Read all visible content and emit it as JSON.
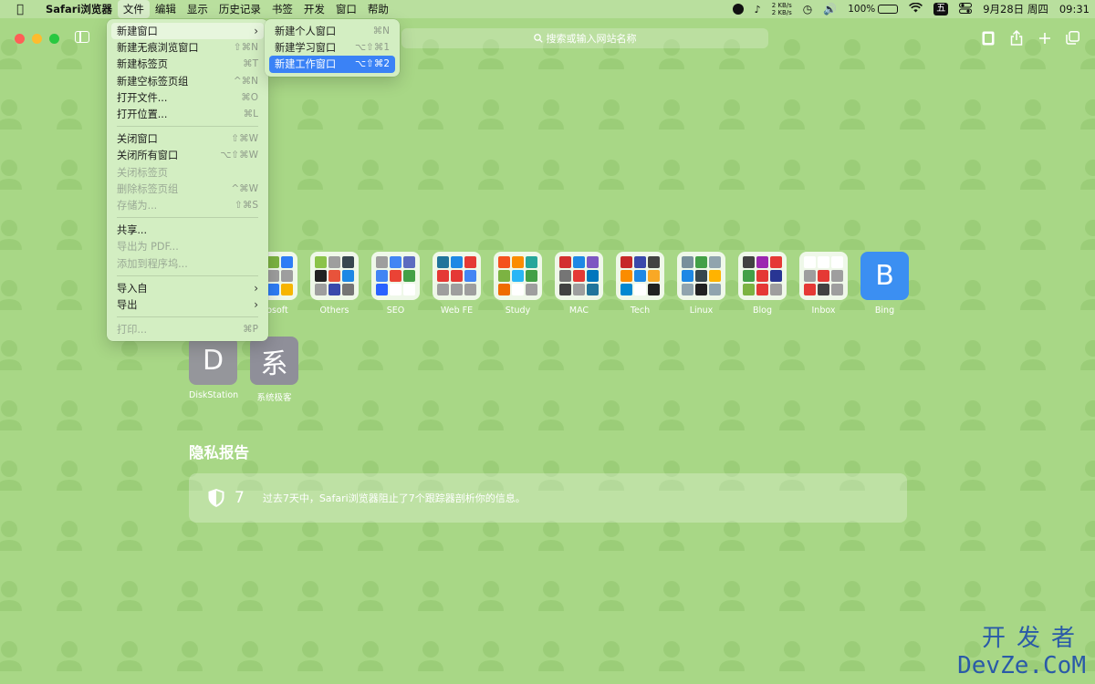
{
  "menubar": {
    "app_name": "Safari浏览器",
    "items": [
      "文件",
      "编辑",
      "显示",
      "历史记录",
      "书签",
      "开发",
      "窗口",
      "帮助"
    ],
    "active_index": 0,
    "status": {
      "net_up": "2 KB/s",
      "net_down": "2 KB/s",
      "battery": "100%",
      "battery_level": 1.0,
      "input_method": "五",
      "date": "9月28日 周四",
      "time": "09:31"
    }
  },
  "toolbar": {
    "address_placeholder": "搜索或输入网站名称"
  },
  "file_menu": [
    {
      "label": "新建窗口",
      "shortcut": "",
      "submenu": true,
      "state": "hover"
    },
    {
      "label": "新建无痕浏览窗口",
      "shortcut": "⇧⌘N"
    },
    {
      "label": "新建标签页",
      "shortcut": "⌘T"
    },
    {
      "label": "新建空标签页组",
      "shortcut": "^⌘N"
    },
    {
      "label": "打开文件...",
      "shortcut": "⌘O"
    },
    {
      "label": "打开位置...",
      "shortcut": "⌘L"
    },
    {
      "sep": true
    },
    {
      "label": "关闭窗口",
      "shortcut": "⇧⌘W"
    },
    {
      "label": "关闭所有窗口",
      "shortcut": "⌥⇧⌘W"
    },
    {
      "label": "关闭标签页",
      "shortcut": "",
      "state": "disabled"
    },
    {
      "label": "删除标签页组",
      "shortcut": "^⌘W",
      "state": "disabled"
    },
    {
      "label": "存储为...",
      "shortcut": "⇧⌘S",
      "state": "disabled"
    },
    {
      "sep": true
    },
    {
      "label": "共享...",
      "shortcut": ""
    },
    {
      "label": "导出为 PDF...",
      "shortcut": "",
      "state": "disabled"
    },
    {
      "label": "添加到程序坞...",
      "shortcut": "",
      "state": "disabled"
    },
    {
      "sep": true
    },
    {
      "label": "导入自",
      "shortcut": "",
      "submenu": true
    },
    {
      "label": "导出",
      "shortcut": "",
      "submenu": true
    },
    {
      "sep": true
    },
    {
      "label": "打印...",
      "shortcut": "⌘P",
      "state": "disabled"
    }
  ],
  "new_window_submenu": [
    {
      "label": "新建个人窗口",
      "shortcut": "⌘N"
    },
    {
      "label": "新建学习窗口",
      "shortcut": "⌥⇧⌘1"
    },
    {
      "label": "新建工作窗口",
      "shortcut": "⌥⇧⌘2",
      "state": "selected"
    }
  ],
  "favorites": [
    {
      "label": "crosoft",
      "icon": "folder",
      "tiles": [
        "#e8533b",
        "#7cb342",
        "#2e7df6",
        "#f7b500",
        "#9e9e9e",
        "#9e9e9e",
        "#e8533b",
        "#2e7df6",
        "#f7b500"
      ]
    },
    {
      "label": "Others",
      "icon": "folder",
      "tiles": [
        "#8bc34a",
        "#9e9e9e",
        "#37474f",
        "#222222",
        "#e8533b",
        "#1e88e5",
        "#9e9e9e",
        "#3949ab",
        "#757575"
      ]
    },
    {
      "label": "SEO",
      "icon": "folder",
      "tiles": [
        "#9e9e9e",
        "#4285f4",
        "#5c6bc0",
        "#4285f4",
        "#ea4335",
        "#43a047",
        "#2962ff",
        "#ffffff",
        "#ffffff"
      ]
    },
    {
      "label": "Web FE",
      "icon": "folder",
      "tiles": [
        "#21759b",
        "#1e88e5",
        "#e53935",
        "#e53935",
        "#e53935",
        "#4285f4",
        "#9e9e9e",
        "#9e9e9e",
        "#9e9e9e"
      ]
    },
    {
      "label": "Study",
      "icon": "folder",
      "tiles": [
        "#f4511e",
        "#fb8c00",
        "#26a69a",
        "#7cb342",
        "#29b6f6",
        "#43a047",
        "#ef6c00",
        "#ffffff",
        "#9e9e9e"
      ]
    },
    {
      "label": "MAC",
      "icon": "folder",
      "tiles": [
        "#d32f2f",
        "#1e88e5",
        "#7e57c2",
        "#757575",
        "#e53935",
        "#0277bd",
        "#424242",
        "#9e9e9e",
        "#21759b"
      ]
    },
    {
      "label": "Tech",
      "icon": "folder",
      "tiles": [
        "#c62828",
        "#3949ab",
        "#424242",
        "#fb8c00",
        "#1e88e5",
        "#f9a825",
        "#0288d1",
        "#ffffff",
        "#212121"
      ]
    },
    {
      "label": "Linux",
      "icon": "folder",
      "tiles": [
        "#78909c",
        "#43a047",
        "#90a4ae",
        "#1e88e5",
        "#37474f",
        "#ffb300",
        "#90a4ae",
        "#212121",
        "#90a4ae"
      ]
    },
    {
      "label": "Blog",
      "icon": "folder",
      "tiles": [
        "#424242",
        "#9c27b0",
        "#e53935",
        "#43a047",
        "#e53935",
        "#283593",
        "#7cb342",
        "#e53935",
        "#9e9e9e"
      ]
    },
    {
      "label": "Inbox",
      "icon": "folder",
      "tiles": [
        "#ffffff",
        "#ffffff",
        "#ffffff",
        "#9e9e9e",
        "#e53935",
        "#9e9e9e",
        "#e53935",
        "#424242",
        "#9e9e9e"
      ]
    },
    {
      "label": "Bing",
      "icon": "letter",
      "letter": "B",
      "color": "#3b8ff2"
    }
  ],
  "favorites_row2": [
    {
      "label": "DiskStation",
      "letter": "D",
      "color": "#95969b"
    },
    {
      "label": "系统极客",
      "letter": "系",
      "color": "#8f8f99"
    }
  ],
  "privacy": {
    "title": "隐私报告",
    "count": "7",
    "text": "过去7天中，Safari浏览器阻止了7个跟踪器剖析你的信息。"
  },
  "watermark": {
    "line1": "开发者",
    "line2": "DevZe.CoM"
  }
}
